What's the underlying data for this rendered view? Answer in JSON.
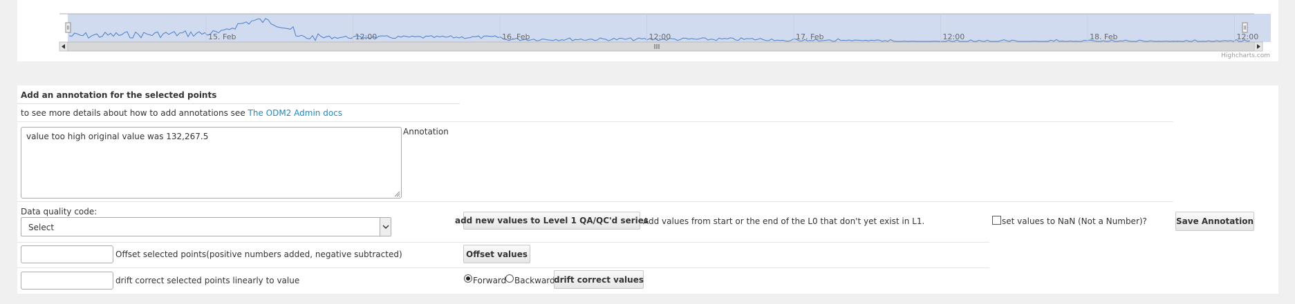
{
  "navigator": {
    "x_labels": [
      "15. Feb",
      "12:00",
      "16. Feb",
      "12:00",
      "17. Feb",
      "12:00",
      "18. Feb",
      "12:00"
    ],
    "credits": "Highcharts.com",
    "colors": {
      "fill": "#d0dbef",
      "line": "#4a7ccc",
      "scrollbar": "#d8d8d8"
    }
  },
  "annotation_form": {
    "title": "Add an annotation for the selected points",
    "help_prefix": "to see more details about how to add annotations see",
    "help_link": "The ODM2 Admin docs",
    "annotation_text": "value too high original value was 132,267.5",
    "annotation_label": "Annotation",
    "data_quality_label": "Data quality code:",
    "data_quality_selected": "Select",
    "add_values_button": "add new values to Level 1 QA/QC'd series",
    "add_values_hint": "Add values from start or the end of the L0 that don't yet exist in L1.",
    "nan_checkbox_label": "set values to NaN (Not a Number)?",
    "nan_checked": false,
    "save_button": "Save Annotation",
    "offset_value": "",
    "offset_label": "Offset selected points(positive numbers added, negative subtracted)",
    "offset_button": "Offset values",
    "drift_value": "",
    "drift_label": "drift correct selected points linearly to value",
    "forward_label": "Forward",
    "backward_label": "Backward",
    "direction_selected": "Forward",
    "drift_button": "drift correct values",
    "link_color": "#1a8bc9"
  }
}
